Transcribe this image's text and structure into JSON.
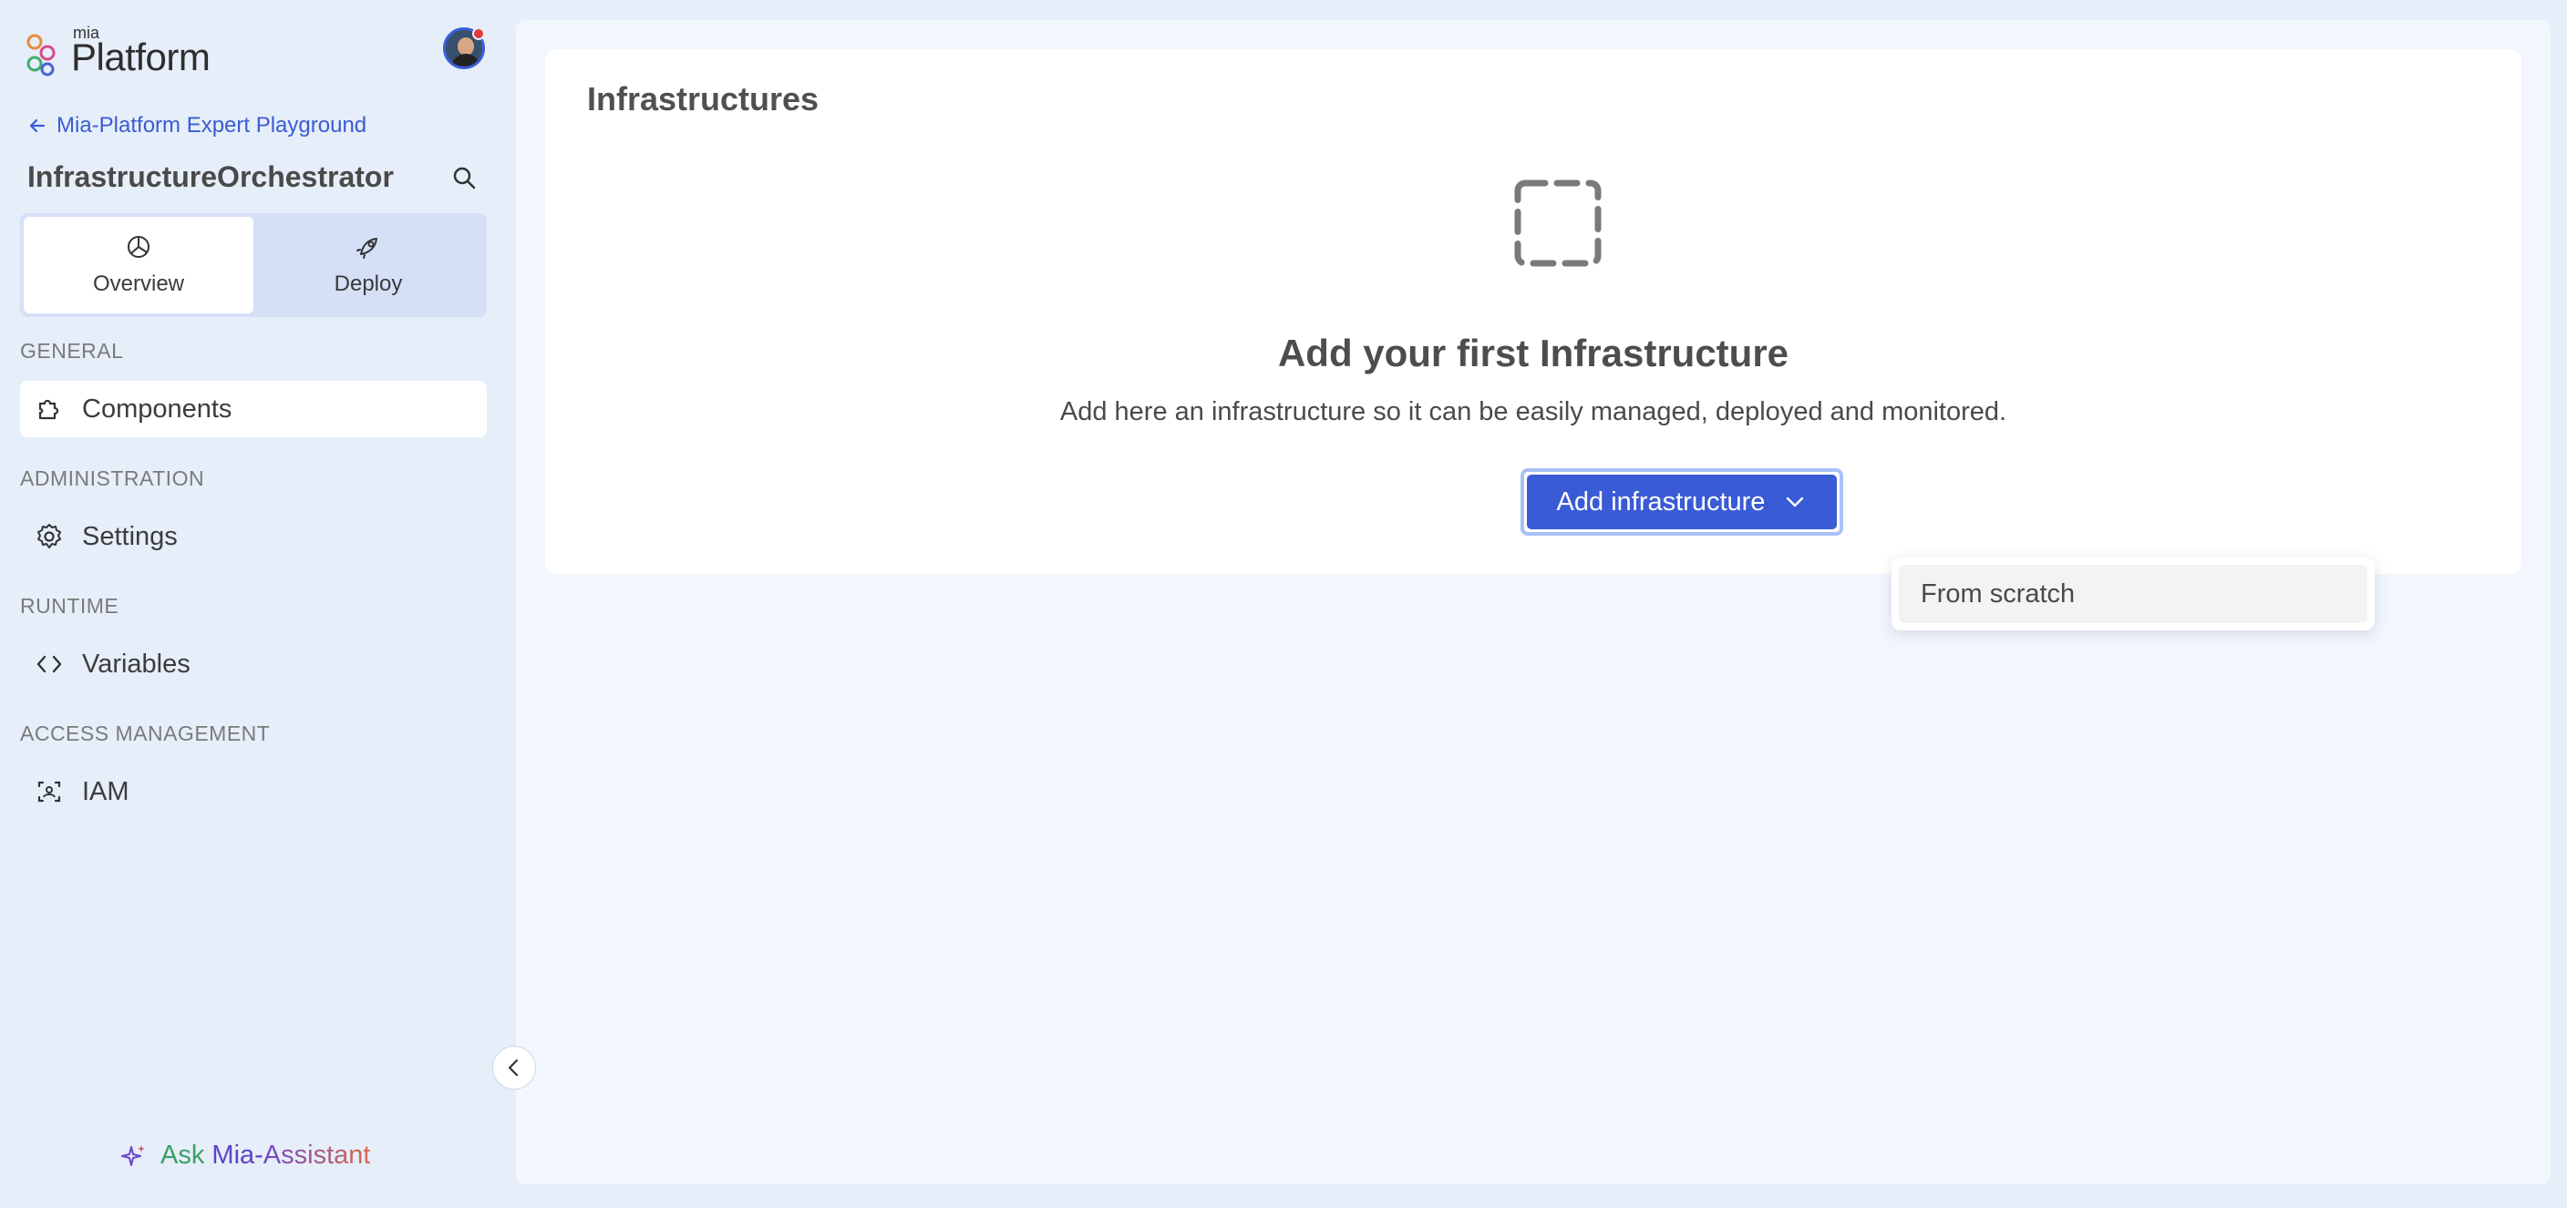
{
  "brand": {
    "small": "mia",
    "name": "Platform"
  },
  "sidebar": {
    "back_link": "Mia-Platform Expert Playground",
    "project_title": "InfrastructureOrchestrator",
    "modes": [
      {
        "label": "Overview",
        "icon": "pie-chart-icon",
        "active": true
      },
      {
        "label": "Deploy",
        "icon": "rocket-icon",
        "active": false
      }
    ],
    "sections": [
      {
        "label": "GENERAL",
        "items": [
          {
            "label": "Components",
            "icon": "puzzle-icon",
            "active": true
          }
        ]
      },
      {
        "label": "ADMINISTRATION",
        "items": [
          {
            "label": "Settings",
            "icon": "gear-icon",
            "active": false
          }
        ]
      },
      {
        "label": "RUNTIME",
        "items": [
          {
            "label": "Variables",
            "icon": "code-icon",
            "active": false
          }
        ]
      },
      {
        "label": "ACCESS MANAGEMENT",
        "items": [
          {
            "label": "IAM",
            "icon": "user-scan-icon",
            "active": false
          }
        ]
      }
    ],
    "assistant": {
      "w1": "Ask",
      "w2": "Mia-",
      "w3": "Assistant"
    }
  },
  "main": {
    "title": "Infrastructures",
    "empty_title": "Add your first Infrastructure",
    "empty_description": "Add here an infrastructure so it can be easily managed, deployed and monitored.",
    "add_button": "Add infrastructure",
    "dropdown_options": [
      "From scratch"
    ]
  },
  "colors": {
    "accent": "#3a5bd6",
    "sidebar_bg": "#e6eef9",
    "main_bg": "#f2f6fd"
  }
}
